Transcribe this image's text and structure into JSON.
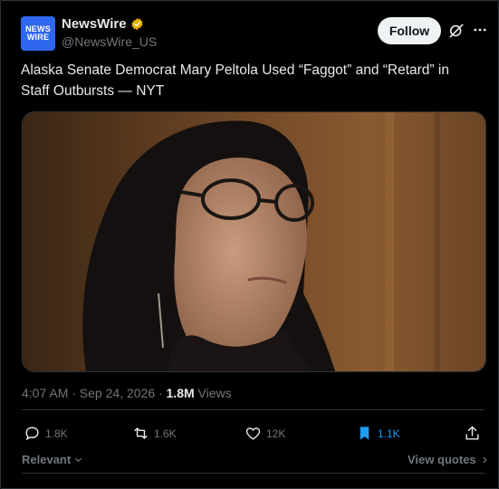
{
  "author": {
    "avatar_line1": "NEWS",
    "avatar_line2": "WIRE",
    "name": "NewsWire",
    "handle": "@NewsWire_US"
  },
  "actions_top": {
    "follow_label": "Follow"
  },
  "post": {
    "text": "Alaska Senate Democrat Mary Peltola Used “Faggot” and “Retard” in Staff Outbursts — NYT"
  },
  "meta": {
    "time": "4:07 AM · Sep 24, 2026 · ",
    "views_count": "1.8M",
    "views_label": " Views"
  },
  "stats": {
    "replies": "1.8K",
    "reposts": "1.6K",
    "likes": "12K",
    "bookmarks": "1.1K"
  },
  "footer": {
    "sort_label": "Relevant",
    "view_quotes_label": "View quotes"
  },
  "colors": {
    "background": "#000000",
    "accent": "#1d9bf0",
    "avatar_bg": "#2f67f0",
    "verified": "#e8b000",
    "muted": "#71767b"
  }
}
